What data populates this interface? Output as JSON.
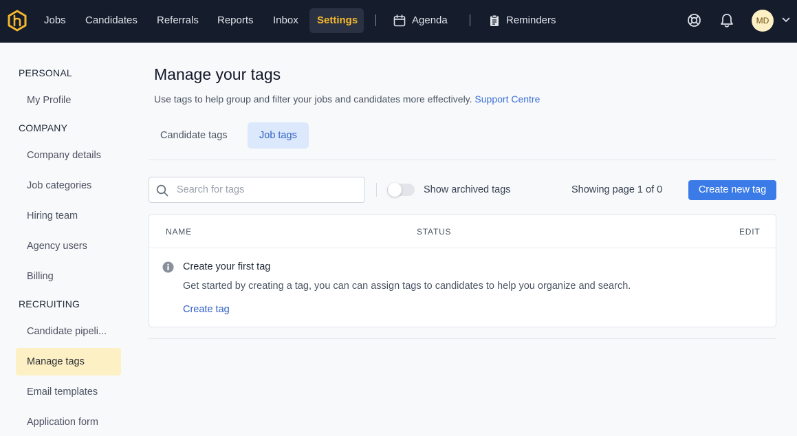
{
  "topnav": {
    "items": [
      {
        "label": "Jobs"
      },
      {
        "label": "Candidates"
      },
      {
        "label": "Referrals"
      },
      {
        "label": "Reports"
      },
      {
        "label": "Inbox"
      },
      {
        "label": "Settings"
      }
    ],
    "agenda_label": "Agenda",
    "reminders_label": "Reminders",
    "avatar_initials": "MD",
    "active_item": "Settings",
    "accent_color": "#f5b82e"
  },
  "sidebar": {
    "personal_heading": "PERSONAL",
    "personal_items": [
      {
        "label": "My Profile"
      }
    ],
    "company_heading": "COMPANY",
    "company_items": [
      {
        "label": "Company details"
      },
      {
        "label": "Job categories"
      },
      {
        "label": "Hiring team"
      },
      {
        "label": "Agency users"
      },
      {
        "label": "Billing"
      }
    ],
    "recruiting_heading": "RECRUITING",
    "recruiting_items": [
      {
        "label": "Candidate pipeli..."
      },
      {
        "label": "Manage tags"
      },
      {
        "label": "Email templates"
      },
      {
        "label": "Application form"
      }
    ],
    "active_item": "Manage tags"
  },
  "main": {
    "title": "Manage your tags",
    "subtitle": "Use tags to help group and filter your jobs and candidates more effectively.",
    "support_link": "Support Centre",
    "tabs": [
      {
        "label": "Candidate tags"
      },
      {
        "label": "Job tags"
      }
    ],
    "active_tab": "Job tags",
    "search": {
      "placeholder": "Search for tags",
      "value": ""
    },
    "archived_toggle": {
      "label": "Show archived tags",
      "on": false
    },
    "paging_text": "Showing page 1 of 0",
    "create_button": "Create new tag",
    "table": {
      "columns": [
        "NAME",
        "STATUS",
        "EDIT"
      ],
      "empty_title": "Create your first tag",
      "empty_description": "Get started by creating a tag, you can can assign tags to candidates to help you organize and search.",
      "empty_link": "Create tag"
    }
  }
}
